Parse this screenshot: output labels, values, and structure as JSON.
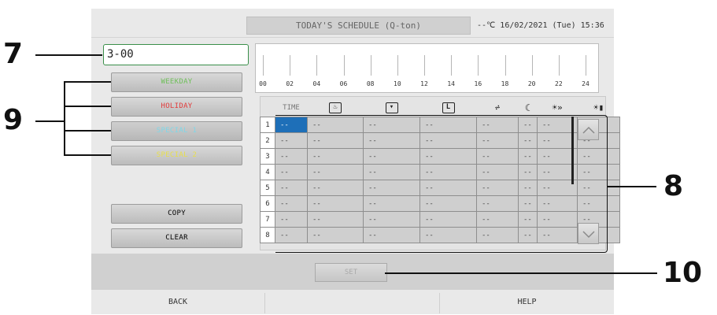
{
  "header": {
    "title": "TODAY'S SCHEDULE (Q-ton)",
    "status": "--℃  16/02/2021 (Tue) 15:36"
  },
  "group": {
    "value": "3-00"
  },
  "timeline": {
    "labels": [
      "00",
      "02",
      "04",
      "06",
      "08",
      "10",
      "12",
      "14",
      "16",
      "18",
      "20",
      "22",
      "24"
    ]
  },
  "day_buttons": [
    {
      "label": "WEEKDAY",
      "color": "#6fbf5a"
    },
    {
      "label": "HOLIDAY",
      "color": "#e23b3b"
    },
    {
      "label": "SPECIAL 1",
      "color": "#7fd7e8"
    },
    {
      "label": "SPECIAL 2",
      "color": "#e8df4a"
    }
  ],
  "actions": {
    "copy": "COPY",
    "clear": "CLEAR",
    "set": "SET"
  },
  "table": {
    "time_header": "TIME",
    "column_icons": [
      "hot-water-temperature-icon",
      "unit-icon",
      "level-L-icon",
      "tariff-icon",
      "night-mode-icon",
      "boost-icon",
      "peak-cut-icon"
    ],
    "rows": [
      {
        "num": "1",
        "cells": [
          "--",
          "--",
          "--",
          "--",
          "--",
          "--",
          "--",
          "--"
        ]
      },
      {
        "num": "2",
        "cells": [
          "--",
          "--",
          "--",
          "--",
          "--",
          "--",
          "--",
          "--"
        ]
      },
      {
        "num": "3",
        "cells": [
          "--",
          "--",
          "--",
          "--",
          "--",
          "--",
          "--",
          "--"
        ]
      },
      {
        "num": "4",
        "cells": [
          "--",
          "--",
          "--",
          "--",
          "--",
          "--",
          "--",
          "--"
        ]
      },
      {
        "num": "5",
        "cells": [
          "--",
          "--",
          "--",
          "--",
          "--",
          "--",
          "--",
          "--"
        ]
      },
      {
        "num": "6",
        "cells": [
          "--",
          "--",
          "--",
          "--",
          "--",
          "--",
          "--",
          "--"
        ]
      },
      {
        "num": "7",
        "cells": [
          "--",
          "--",
          "--",
          "--",
          "--",
          "--",
          "--",
          "--"
        ]
      },
      {
        "num": "8",
        "cells": [
          "--",
          "--",
          "--",
          "--",
          "--",
          "--",
          "--",
          "--"
        ]
      }
    ]
  },
  "nav": {
    "back": "BACK",
    "help": "HELP"
  },
  "callouts": {
    "c7": "7",
    "c8": "8",
    "c9": "9",
    "c10": "10"
  }
}
